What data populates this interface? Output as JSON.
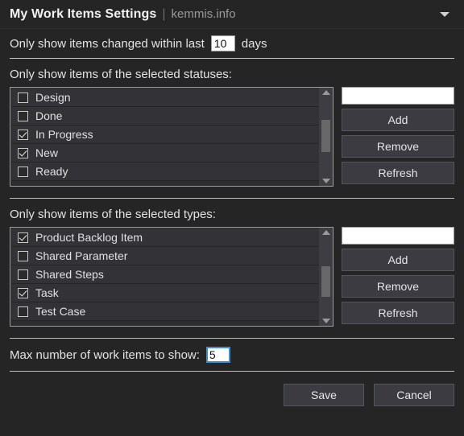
{
  "titlebar": {
    "title": "My Work Items Settings",
    "separator": "|",
    "subtitle": "kemmis.info",
    "caret_icon": "chevron-down-icon"
  },
  "days_filter": {
    "prefix": "Only show items changed within last",
    "value": "10",
    "suffix": "days"
  },
  "statuses_section": {
    "label": "Only show items of the selected statuses:",
    "items": [
      {
        "label": "Design",
        "checked": false
      },
      {
        "label": "Done",
        "checked": false
      },
      {
        "label": "In Progress",
        "checked": true
      },
      {
        "label": "New",
        "checked": true
      },
      {
        "label": "Ready",
        "checked": false
      }
    ],
    "input_value": "",
    "input_placeholder": "",
    "buttons": [
      "Add",
      "Remove",
      "Refresh"
    ]
  },
  "types_section": {
    "label": "Only show items of the selected types:",
    "items": [
      {
        "label": "Product Backlog Item",
        "checked": true
      },
      {
        "label": "Shared Parameter",
        "checked": false
      },
      {
        "label": "Shared Steps",
        "checked": false
      },
      {
        "label": "Task",
        "checked": true
      },
      {
        "label": "Test Case",
        "checked": false
      }
    ],
    "input_value": "",
    "input_placeholder": "",
    "buttons": [
      "Add",
      "Remove",
      "Refresh"
    ]
  },
  "max_items": {
    "label": "Max number of work items to show:",
    "value": "5"
  },
  "footer": {
    "save_label": "Save",
    "cancel_label": "Cancel"
  },
  "colors": {
    "window_bg": "#252526",
    "list_bg": "#2d2d30",
    "row_bg": "#333337",
    "button_bg": "#3b3b41",
    "text": "#e6e6e6",
    "muted_text": "#9a9a9a",
    "separator": "#c8c8c8",
    "focus_border": "#3f8fd0",
    "input_bg": "#ffffff"
  }
}
